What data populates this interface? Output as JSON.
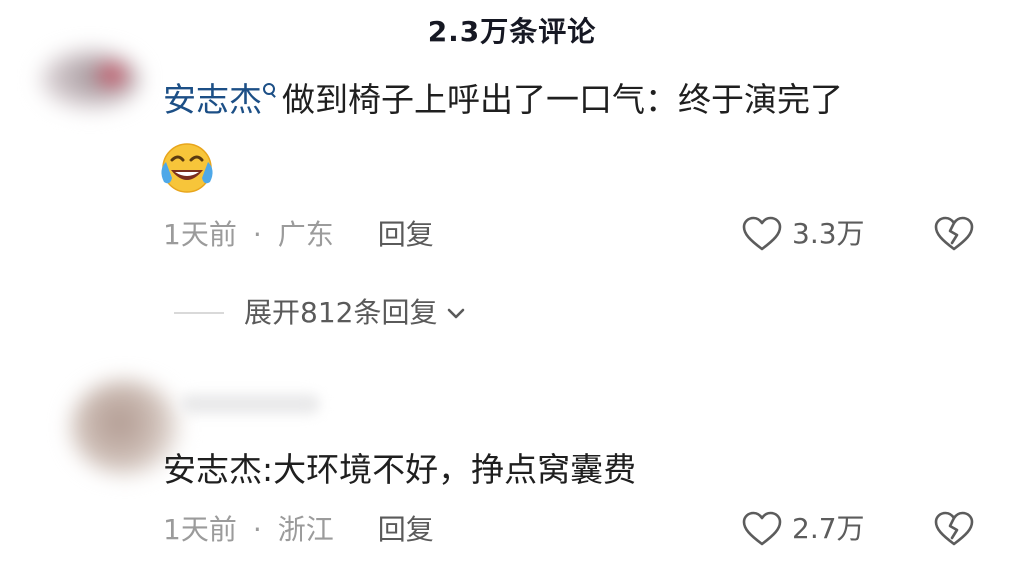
{
  "header": {
    "title": "2.3万条评论"
  },
  "comments": [
    {
      "name": "安志杰",
      "text": "做到椅子上呼出了一口气：终于演完了",
      "emoji": "laughing-crying-emoji",
      "time": "1天前",
      "separator": "·",
      "location": "广东",
      "reply_label": "回复",
      "likes": "3.3万",
      "expand_label": "展开812条回复"
    },
    {
      "text": "安志杰:大环境不好，挣点窝囊费",
      "time": "1天前",
      "separator": "·",
      "location": "浙江",
      "reply_label": "回复",
      "likes": "2.7万"
    }
  ],
  "icons": {
    "like": "heart-outline-icon",
    "dislike": "broken-heart-icon",
    "expand": "chevron-down-icon",
    "search": "search-icon"
  },
  "colors": {
    "name_link": "#1c4f86",
    "meta_gray": "#9b9b9b",
    "icon_gray": "#5c5c5c"
  }
}
